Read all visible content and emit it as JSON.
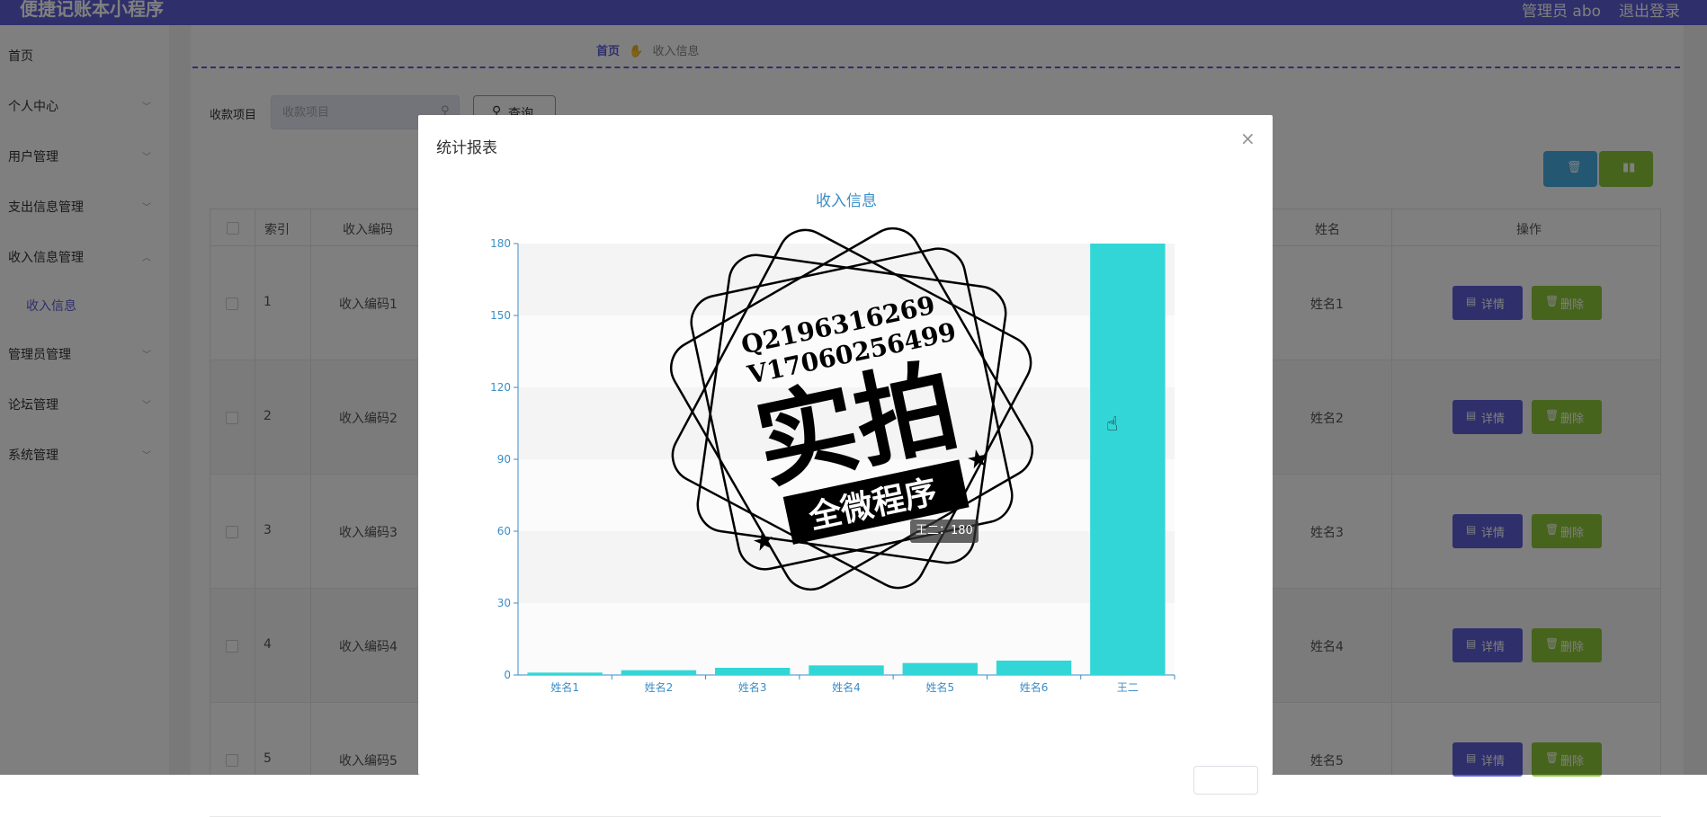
{
  "header": {
    "title": "便捷记账本小程序",
    "admin": "管理员 abo",
    "logout": "退出登录"
  },
  "sidebar": {
    "items": [
      {
        "label": "首页",
        "chevron": ""
      },
      {
        "label": "个人中心",
        "chevron": "﹀"
      },
      {
        "label": "用户管理",
        "chevron": "﹀"
      },
      {
        "label": "支出信息管理",
        "chevron": "﹀"
      },
      {
        "label": "收入信息管理",
        "chevron": "︿"
      },
      {
        "label": "收入信息",
        "chevron": ""
      },
      {
        "label": "管理员管理",
        "chevron": "﹀"
      },
      {
        "label": "论坛管理",
        "chevron": "﹀"
      },
      {
        "label": "系统管理",
        "chevron": "﹀"
      }
    ]
  },
  "breadcrumb": {
    "home": "首页",
    "current": "收入信息"
  },
  "search": {
    "label": "收款项目",
    "placeholder": "收款项目",
    "button": "查询"
  },
  "table": {
    "headers": {
      "index": "索引",
      "code": "收入编码",
      "name": "姓名",
      "actions": "操作"
    },
    "detail_label": "详情",
    "delete_label": "删除",
    "rows": [
      {
        "index": "1",
        "code": "收入编码1",
        "name": "姓名1"
      },
      {
        "index": "2",
        "code": "收入编码2",
        "name": "姓名2"
      },
      {
        "index": "3",
        "code": "收入编码3",
        "name": "姓名3"
      },
      {
        "index": "4",
        "code": "收入编码4",
        "name": "姓名4"
      },
      {
        "index": "5",
        "code": "收入编码5",
        "name": "姓名5"
      }
    ]
  },
  "dialog": {
    "title": "统计报表",
    "close": "×"
  },
  "tooltip": "王二：180",
  "watermark": {
    "line1": "Q2196316269",
    "line2": "V17060256499",
    "main": "实拍",
    "banner": "全微程序"
  },
  "colors": {
    "primary": "#5f5fd9",
    "bar": "#33d6d6",
    "axis": "#3b8ec7",
    "success": "#8fc93a",
    "info": "#48aee3"
  },
  "chart_data": {
    "type": "bar",
    "title": "收入信息",
    "categories": [
      "姓名1",
      "姓名2",
      "姓名3",
      "姓名4",
      "姓名5",
      "姓名6",
      "王二"
    ],
    "values": [
      1,
      2,
      3,
      4,
      5,
      6,
      180
    ],
    "ylim": [
      0,
      180
    ],
    "yticks": [
      0,
      30,
      60,
      90,
      120,
      150,
      180
    ]
  }
}
